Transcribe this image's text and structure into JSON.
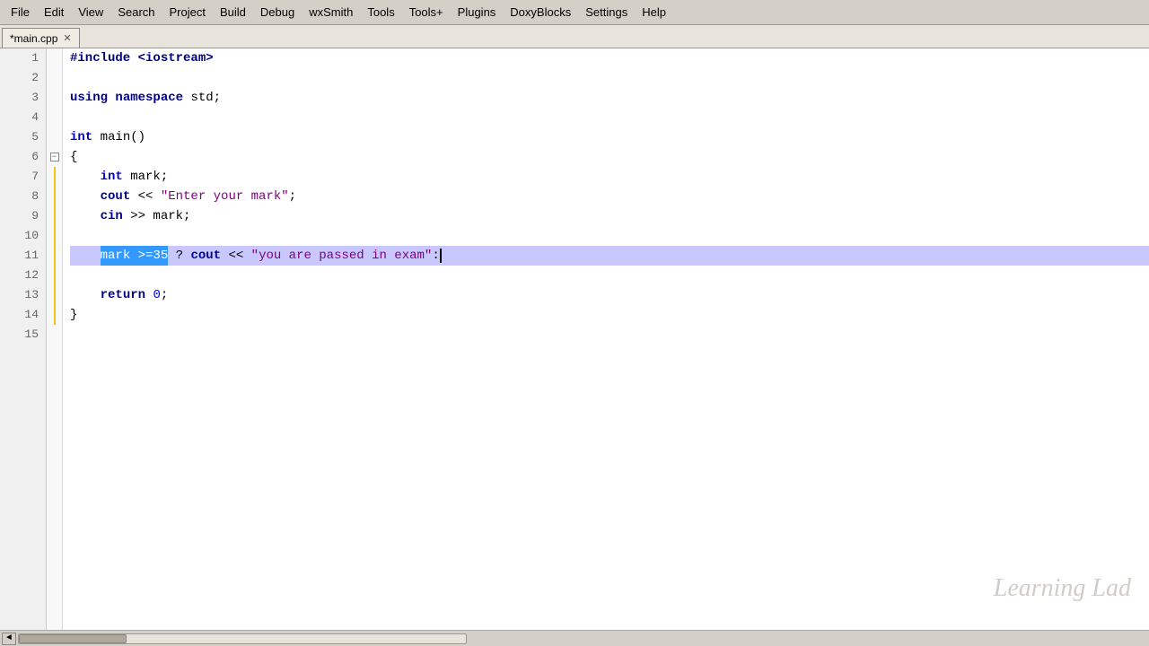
{
  "menubar": {
    "items": [
      "File",
      "Edit",
      "View",
      "Search",
      "Project",
      "Build",
      "Debug",
      "wxSmith",
      "Tools",
      "Tools+",
      "Plugins",
      "DoxyBlocks",
      "Settings",
      "Help"
    ]
  },
  "tab": {
    "title": "*main.cpp",
    "close_icon": "✕"
  },
  "watermark": "Learning Lad",
  "lines": [
    {
      "num": 1,
      "fold": "",
      "content": [
        {
          "type": "pp",
          "text": "#include <iostream>"
        }
      ]
    },
    {
      "num": 2,
      "fold": "",
      "content": []
    },
    {
      "num": 3,
      "fold": "",
      "content": [
        {
          "type": "kw",
          "text": "using"
        },
        {
          "type": "normal",
          "text": " "
        },
        {
          "type": "kw",
          "text": "namespace"
        },
        {
          "type": "normal",
          "text": " std;"
        }
      ]
    },
    {
      "num": 4,
      "fold": "",
      "content": []
    },
    {
      "num": 5,
      "fold": "",
      "content": [
        {
          "type": "type-kw",
          "text": "int"
        },
        {
          "type": "normal",
          "text": " main()"
        }
      ]
    },
    {
      "num": 6,
      "fold": "minus",
      "content": [
        {
          "type": "normal",
          "text": "{"
        }
      ]
    },
    {
      "num": 7,
      "fold": "line",
      "content": [
        {
          "type": "normal",
          "text": "    "
        },
        {
          "type": "type-kw",
          "text": "int"
        },
        {
          "type": "normal",
          "text": " mark;"
        }
      ]
    },
    {
      "num": 8,
      "fold": "line",
      "content": [
        {
          "type": "normal",
          "text": "    "
        },
        {
          "type": "kw",
          "text": "cout"
        },
        {
          "type": "normal",
          "text": " << "
        },
        {
          "type": "string",
          "text": "\"Enter your mark\""
        },
        {
          "type": "normal",
          "text": ";"
        }
      ]
    },
    {
      "num": 9,
      "fold": "line",
      "content": [
        {
          "type": "normal",
          "text": "    "
        },
        {
          "type": "kw",
          "text": "cin"
        },
        {
          "type": "normal",
          "text": " >> mark;"
        }
      ]
    },
    {
      "num": 10,
      "fold": "line",
      "content": []
    },
    {
      "num": 11,
      "fold": "line",
      "highlight": true,
      "content": [
        {
          "type": "normal",
          "text": "    mark >=35 ? "
        },
        {
          "type": "kw",
          "text": "cout"
        },
        {
          "type": "normal",
          "text": " << "
        },
        {
          "type": "string",
          "text": "\"you are passed in exam\""
        },
        {
          "type": "normal",
          "text": ":"
        },
        {
          "type": "cursor",
          "text": ""
        }
      ]
    },
    {
      "num": 12,
      "fold": "line",
      "content": []
    },
    {
      "num": 13,
      "fold": "line",
      "content": [
        {
          "type": "normal",
          "text": "    "
        },
        {
          "type": "kw",
          "text": "return"
        },
        {
          "type": "normal",
          "text": " "
        },
        {
          "type": "number",
          "text": "0"
        },
        {
          "type": "normal",
          "text": ";"
        }
      ]
    },
    {
      "num": 14,
      "fold": "line",
      "content": [
        {
          "type": "normal",
          "text": "}"
        }
      ]
    },
    {
      "num": 15,
      "fold": "",
      "content": []
    }
  ],
  "scrollbar": {
    "arrow_left": "◄"
  }
}
